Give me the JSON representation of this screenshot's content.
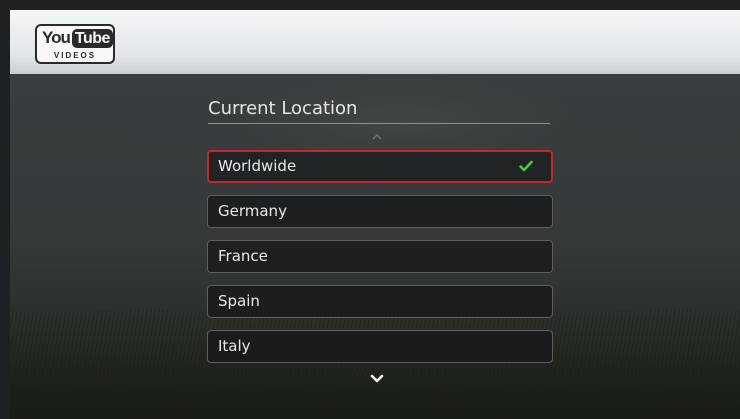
{
  "header": {
    "logo": {
      "you": "You",
      "tube": "Tube",
      "sub": "VIDEOS"
    }
  },
  "main": {
    "title": "Current Location",
    "selected_index": 0,
    "items": [
      {
        "label": "Worldwide",
        "selected": true
      },
      {
        "label": "Germany"
      },
      {
        "label": "France"
      },
      {
        "label": "Spain"
      },
      {
        "label": "Italy"
      }
    ]
  },
  "icons": {
    "check": "check-icon",
    "up": "chevron-up-icon",
    "down": "chevron-down-icon"
  },
  "colors": {
    "selection_border": "#c3282d",
    "check": "#4cc92c"
  }
}
